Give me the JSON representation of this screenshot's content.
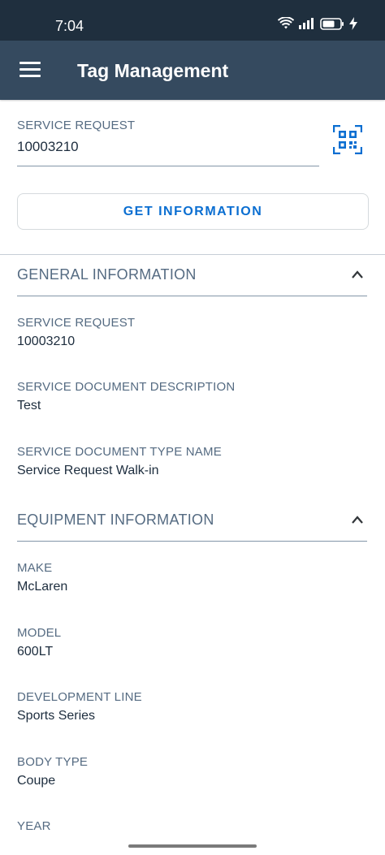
{
  "status": {
    "time": "7:04",
    "icons": [
      "wifi-icon",
      "signal-icon",
      "battery-icon",
      "charging-icon"
    ]
  },
  "app_bar": {
    "title": "Tag Management",
    "menu_icon": "hamburger-menu-icon"
  },
  "service_request_input": {
    "label": "SERVICE REQUEST",
    "value": "10003210",
    "scan_icon": "qr-code-scan-icon"
  },
  "get_information_button": "GET INFORMATION",
  "general_information": {
    "title": "GENERAL INFORMATION",
    "fields": [
      {
        "label": "SERVICE REQUEST",
        "value": "10003210"
      },
      {
        "label": "SERVICE DOCUMENT DESCRIPTION",
        "value": "Test"
      },
      {
        "label": "SERVICE DOCUMENT TYPE NAME",
        "value": "Service Request Walk-in"
      }
    ]
  },
  "equipment_information": {
    "title": "EQUIPMENT INFORMATION",
    "fields": [
      {
        "label": "MAKE",
        "value": "McLaren"
      },
      {
        "label": "MODEL",
        "value": "600LT"
      },
      {
        "label": "DEVELOPMENT LINE",
        "value": "Sports Series"
      },
      {
        "label": "BODY TYPE",
        "value": "Coupe"
      },
      {
        "label": "YEAR",
        "value": ""
      }
    ]
  },
  "colors": {
    "status_bar": "#1f2f3e",
    "app_bar": "#354a5f",
    "accent": "#0a6ed1",
    "label": "#556b82"
  }
}
